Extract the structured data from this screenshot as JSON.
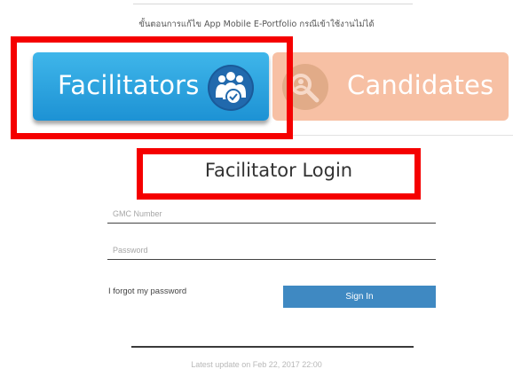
{
  "instruction": "ขั้นตอนการแก้ไข App Mobile E-Portfolio กรณีเข้าใช้งานไม่ได้",
  "tiles": {
    "facilitators": {
      "label": "Facilitators",
      "icon": "group-check-icon",
      "color": "#2aa3df"
    },
    "candidates": {
      "label": "Candidates",
      "icon": "group-search-icon",
      "color": "#f7c0a4"
    }
  },
  "login": {
    "title": "Facilitator Login",
    "gmc_placeholder": "GMC Number",
    "password_placeholder": "Password",
    "forgot_label": "I forgot my password",
    "signin_label": "Sign In"
  },
  "footer": {
    "note": "Latest update on Feb 22, 2017 22:00"
  },
  "highlight_color": "#f50000"
}
